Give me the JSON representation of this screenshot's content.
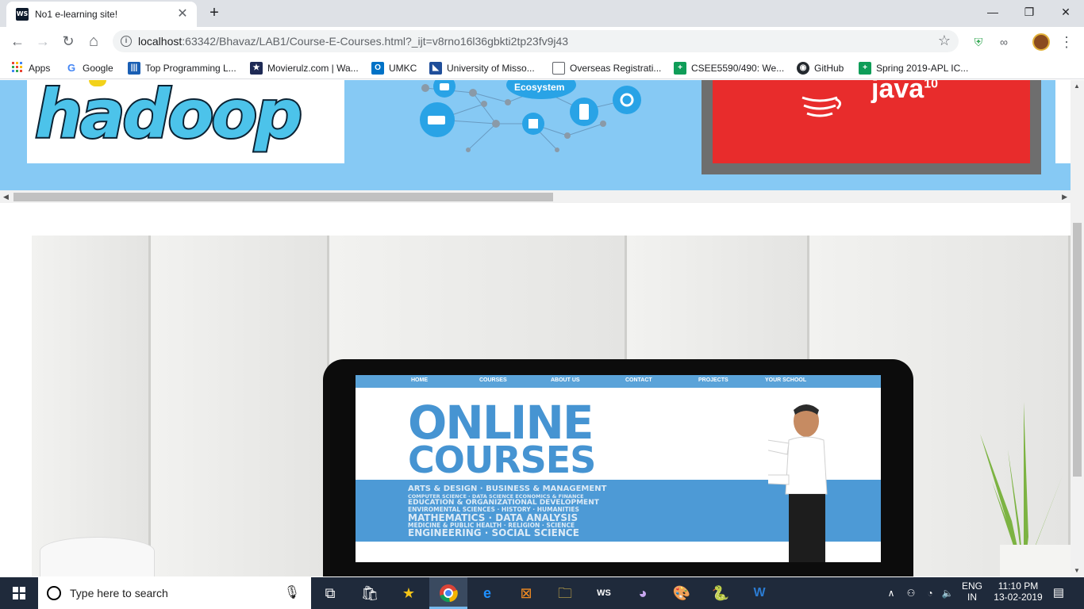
{
  "tab": {
    "title": "No1 e-learning site!",
    "favicon_text": "WS",
    "close": "✕"
  },
  "newtab": "+",
  "window": {
    "minimize": "—",
    "maximize": "❐",
    "close": "✕"
  },
  "toolbar": {
    "back": "←",
    "forward": "→",
    "reload": "↻",
    "home": "⌂",
    "info": "i",
    "url_host": "localhost",
    "url_path": ":63342/Bhavaz/LAB1/Course-E-Courses.html?_ijt=v8rno16l36gbkti2tp23fv9j43",
    "star": "☆"
  },
  "extensions": {
    "shield": "⛨",
    "glasses": "∞",
    "menu": "⋮"
  },
  "bookmarks": [
    {
      "label": "Apps",
      "icon": "apps-icon",
      "color": "#ea4335"
    },
    {
      "label": "Google",
      "icon": "google-icon",
      "color": "#4285f4"
    },
    {
      "label": "Top Programming L...",
      "icon": "bars-icon",
      "color": "#1a5fb4"
    },
    {
      "label": "Movierulz.com | Wa...",
      "icon": "movie-icon",
      "color": "#1e2a55"
    },
    {
      "label": "UMKC",
      "icon": "outlook-icon",
      "color": "#0072c6"
    },
    {
      "label": "University of Misso...",
      "icon": "flag-icon",
      "color": "#1f4e9a"
    },
    {
      "label": "Overseas Registrati...",
      "icon": "page-icon",
      "color": "#ffffff"
    },
    {
      "label": "CSEE5590/490: We...",
      "icon": "sheets-icon",
      "color": "#0f9d58"
    },
    {
      "label": "GitHub",
      "icon": "github-icon",
      "color": "#24292e"
    },
    {
      "label": "Spring 2019-APL IC...",
      "icon": "sheets-icon",
      "color": "#0f9d58"
    }
  ],
  "carousel": {
    "hadoop_logo": "hadoop",
    "eco_label": "Ecosystem",
    "java_logo": "java",
    "java_version": "10"
  },
  "hero": {
    "nav": [
      "HOME",
      "COURSES",
      "ABOUT US",
      "CONTACT",
      "PROJECTS",
      "YOUR SCHOOL"
    ],
    "title1": "ONLINE",
    "title2": "COURSES",
    "band": [
      "ARTS & DESIGN · BUSINESS & MANAGEMENT",
      "COMPUTER SCIENCE · DATA SCIENCE ECONOMICS & FINANCE",
      "EDUCATION & ORGANIZATIONAL DEVELOPMENT",
      "ENVIROMENTAL SCIENCES · HISTORY · HUMANITIES",
      "MATHEMATICS · DATA ANALYSIS",
      "MEDICINE & PUBLIC HEALTH · RELIGION · SCIENCE",
      "ENGINEERING · SOCIAL SCIENCE"
    ]
  },
  "scroll": {
    "left": "◀",
    "right": "▶",
    "up": "▲",
    "down": "▼"
  },
  "taskbar": {
    "search_placeholder": "Type here to search",
    "lang_top": "ENG",
    "lang_bottom": "IN",
    "time": "11:10 PM",
    "date": "13-02-2019",
    "caret": "∧",
    "network": "⚇",
    "wifi": "◔",
    "volume": "🔈",
    "notifications": "▤"
  },
  "colors": {
    "carousel_bg": "#86c9f4",
    "taskbar_bg": "#1f2a3b",
    "accent": "#4694d2"
  }
}
